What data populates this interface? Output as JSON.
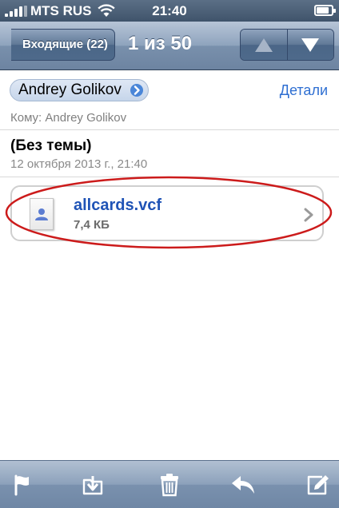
{
  "status_bar": {
    "carrier": "MTS RUS",
    "time": "21:40",
    "battery_level": 0.85
  },
  "nav": {
    "back_label": "Входящие (22)",
    "title": "1 из 50",
    "prev_icon": "triangle-up-icon",
    "next_icon": "triangle-down-icon"
  },
  "message": {
    "from_name": "Andrey Golikov",
    "details_label": "Детали",
    "to_line": "Кому: Andrey Golikov",
    "subject": "(Без темы)",
    "date": "12 октября 2013 г., 21:40"
  },
  "attachment": {
    "name": "allcards.vcf",
    "size": "7,4 КБ",
    "icon": "vcard-file-icon"
  },
  "toolbar": {
    "buttons": [
      "flag-icon",
      "move-to-folder-icon",
      "trash-icon",
      "reply-icon",
      "compose-icon"
    ]
  },
  "colors": {
    "link_blue": "#2f6fd2",
    "attachment_name": "#1f53b6",
    "annotation_red": "#cc1b1b",
    "navbar": "#7990ac"
  }
}
